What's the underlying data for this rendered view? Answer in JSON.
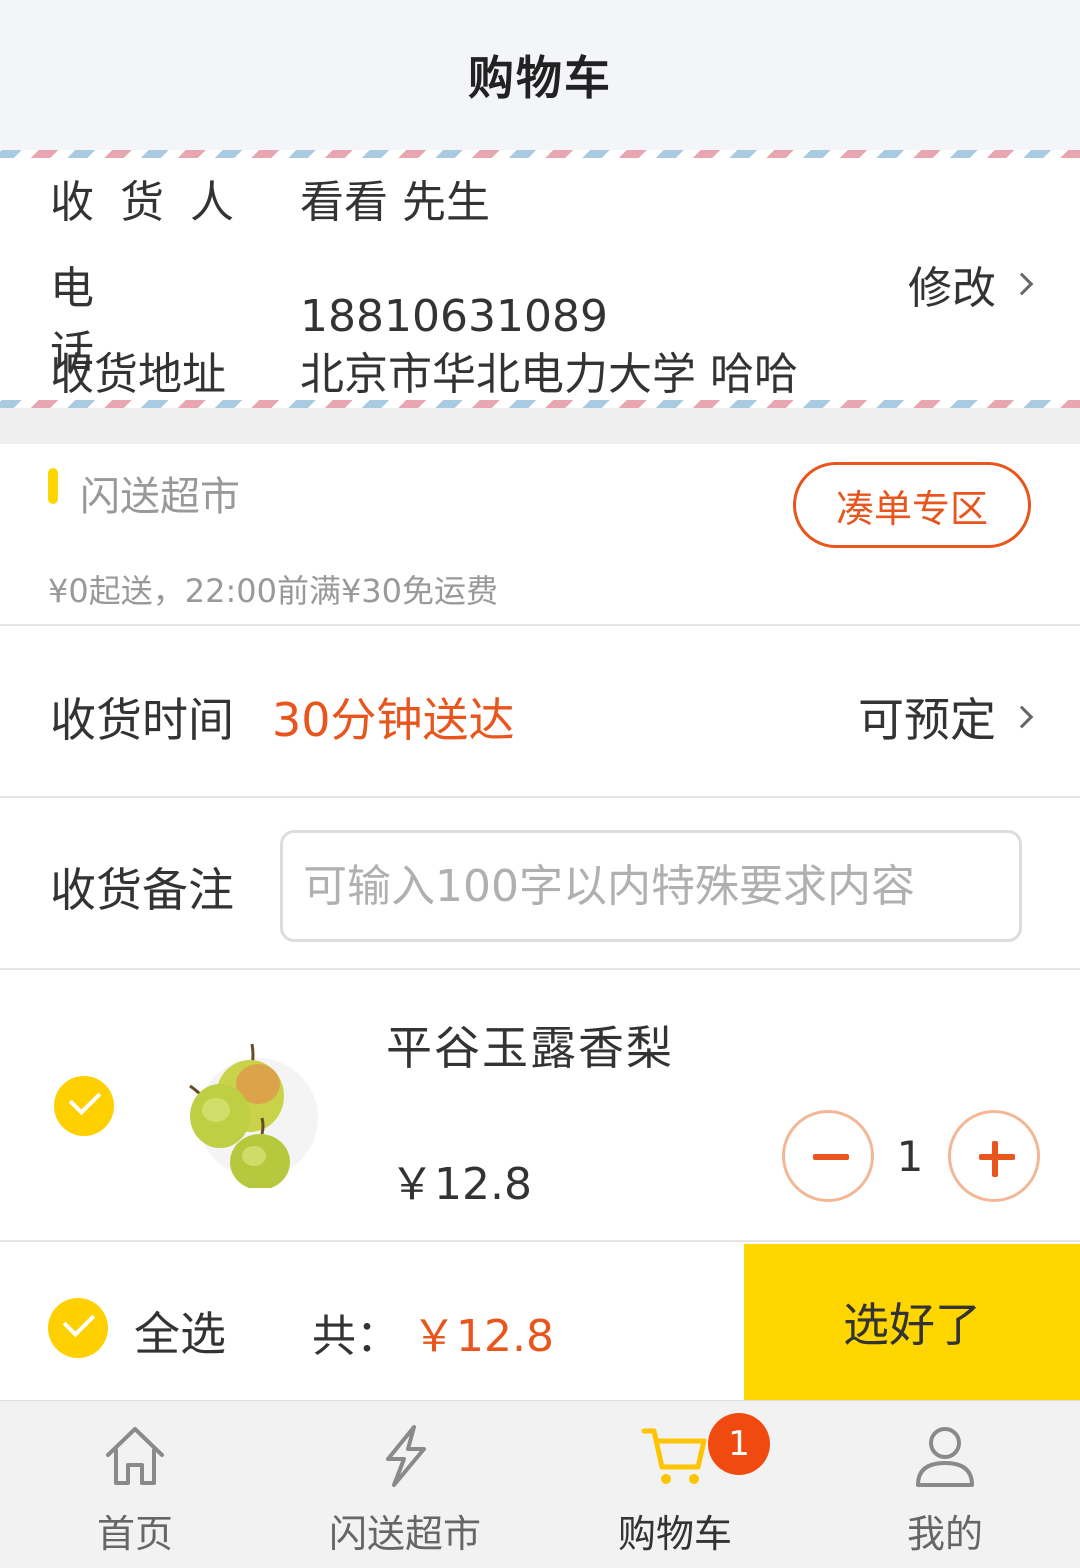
{
  "header": {
    "title": "购物车"
  },
  "address": {
    "receiver_label": "收货人",
    "receiver_value": "看看 先生",
    "phone_label": "电话",
    "phone_value": "18810631089",
    "address_label": "收货地址",
    "address_value": "北京市华北电力大学 哈哈",
    "edit_label": "修改"
  },
  "store": {
    "name": "闪送超市",
    "combine_label": "凑单专区",
    "note": "¥0起送，22:00前满¥30免运费"
  },
  "delivery": {
    "label": "收货时间",
    "value": "30分钟送达",
    "reserve_label": "可预定"
  },
  "remark": {
    "label": "收货备注",
    "placeholder": "可输入100字以内特殊要求内容",
    "value": ""
  },
  "items": [
    {
      "name": "平谷玉露香梨",
      "price": "￥12.8",
      "quantity": "1",
      "checked": true
    }
  ],
  "checkout": {
    "select_all_label": "全选",
    "total_label": "共：",
    "total_value": "￥12.8",
    "confirm_label": "选好了"
  },
  "tabbar": {
    "tabs": [
      {
        "label": "首页",
        "icon": "home-icon"
      },
      {
        "label": "闪送超市",
        "icon": "lightning-icon"
      },
      {
        "label": "购物车",
        "icon": "cart-icon",
        "active": true,
        "badge": "1"
      },
      {
        "label": "我的",
        "icon": "user-icon"
      }
    ]
  },
  "colors": {
    "accent_orange": "#e8551d",
    "accent_yellow": "#ffd600",
    "badge_red": "#f04a11"
  }
}
